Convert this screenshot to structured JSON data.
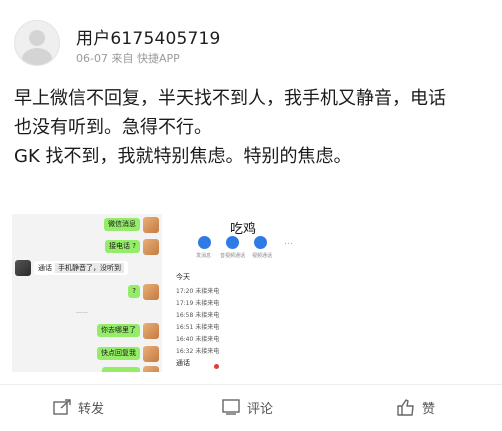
{
  "user": {
    "name": "用户6175405719",
    "meta": "06-07 来自 快捷APP"
  },
  "post": {
    "lines": [
      "早上微信不回复，半天找不到人，我手机又静音，电话",
      "也没有听到。急得不行。",
      "GK 找不到，我就特别焦虑。特别的焦虑。"
    ]
  },
  "chat": {
    "messages": [
      {
        "side": "right",
        "text": "微信消息"
      },
      {
        "side": "right",
        "text": "接电话 ?"
      },
      {
        "side": "left",
        "text": "通话",
        "inner": "手机静音了，没听到"
      },
      {
        "side": "right",
        "text": "?"
      },
      {
        "side": "center",
        "text": "——"
      },
      {
        "side": "right",
        "text": "你去哪里了"
      },
      {
        "side": "right",
        "text": "快点回复我"
      },
      {
        "side": "right",
        "text": ""
      }
    ]
  },
  "contact": {
    "name": "吃鸡",
    "actions": [
      "发消息",
      "音视频通话",
      "视频通话"
    ],
    "more": "…",
    "calls_title": "今天",
    "calls": [
      "17:20 未接来电",
      "17:19 未接来电",
      "16:58 未接来电",
      "16:51 未接来电",
      "16:40 未接来电",
      "16:32 未接来电"
    ],
    "footer": "通话"
  },
  "actions": {
    "repost": "转发",
    "comment": "评论",
    "like": "赞"
  },
  "colors": {
    "accent": "#2f7be6",
    "bubble": "#95ec69"
  }
}
